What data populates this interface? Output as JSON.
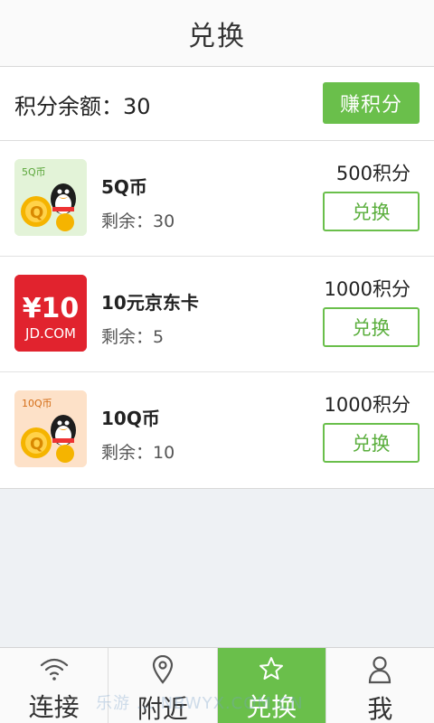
{
  "header": {
    "title": "兑换"
  },
  "points": {
    "balance_text": "积分余额：30",
    "earn_label": "赚积分"
  },
  "items": [
    {
      "name": "5Q币",
      "remain": "剩余：30",
      "cost": "500积分",
      "button": "兑换",
      "thumb_text": "5Q币"
    },
    {
      "name": "10元京东卡",
      "remain": "剩余：5",
      "cost": "1000积分",
      "button": "兑换",
      "thumb_big": "¥10",
      "thumb_small": "JD.COM"
    },
    {
      "name": "10Q币",
      "remain": "剩余：10",
      "cost": "1000积分",
      "button": "兑换",
      "thumb_text": "10Q币"
    }
  ],
  "nav": [
    {
      "label": "连接",
      "icon": "wifi-icon",
      "active": false
    },
    {
      "label": "附近",
      "icon": "location-pin-icon",
      "active": false
    },
    {
      "label": "兑换",
      "icon": "star-icon",
      "active": true
    },
    {
      "label": "我",
      "icon": "user-icon",
      "active": false
    }
  ],
  "watermark": "乐游 ... NBWYX.COM.CN",
  "colors": {
    "accent": "#6abf4b",
    "background": "#eef1f4",
    "jd_red": "#e1232e"
  }
}
